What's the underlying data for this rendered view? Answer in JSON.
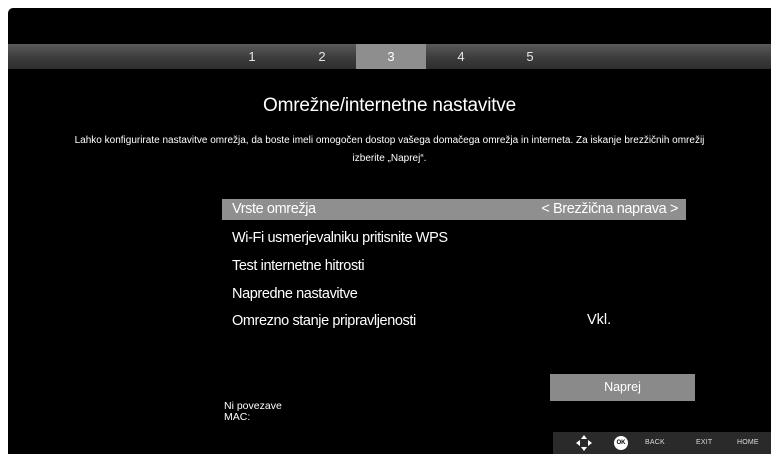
{
  "steps": [
    "1",
    "2",
    "3",
    "4",
    "5"
  ],
  "active_step": "3",
  "title": "Omrežne/internetne nastavitve",
  "description": "Lahko konfigurirate nastavitve omrežja, da boste imeli omogočen dostop vašega domačega omrežja in interneta. Za iskanje brezžičnih omrežij izberite „Naprej“.",
  "menu": {
    "network_type_label": "Vrste omrežja",
    "network_type_value": "< Brezžična naprava >",
    "wps_label": "Wi-Fi usmerjevalniku pritisnite WPS",
    "speed_test_label": "Test internetne hitrosti",
    "advanced_label": "Napredne nastavitve",
    "standby_label": "Omrezno stanje pripravljenosti",
    "standby_value": "Vkl."
  },
  "next_button": "Naprej",
  "status": {
    "connection": "Ni povezave",
    "mac_label": "MAC:"
  },
  "legend": {
    "nav_icon": "dpad-icon",
    "ok_label": "OK",
    "back_label": "BACK",
    "exit_label": "EXIT",
    "home_label": "HOME"
  },
  "colors": {
    "background": "#000000",
    "highlight": "#8f8f8f",
    "text": "#ffffff"
  }
}
